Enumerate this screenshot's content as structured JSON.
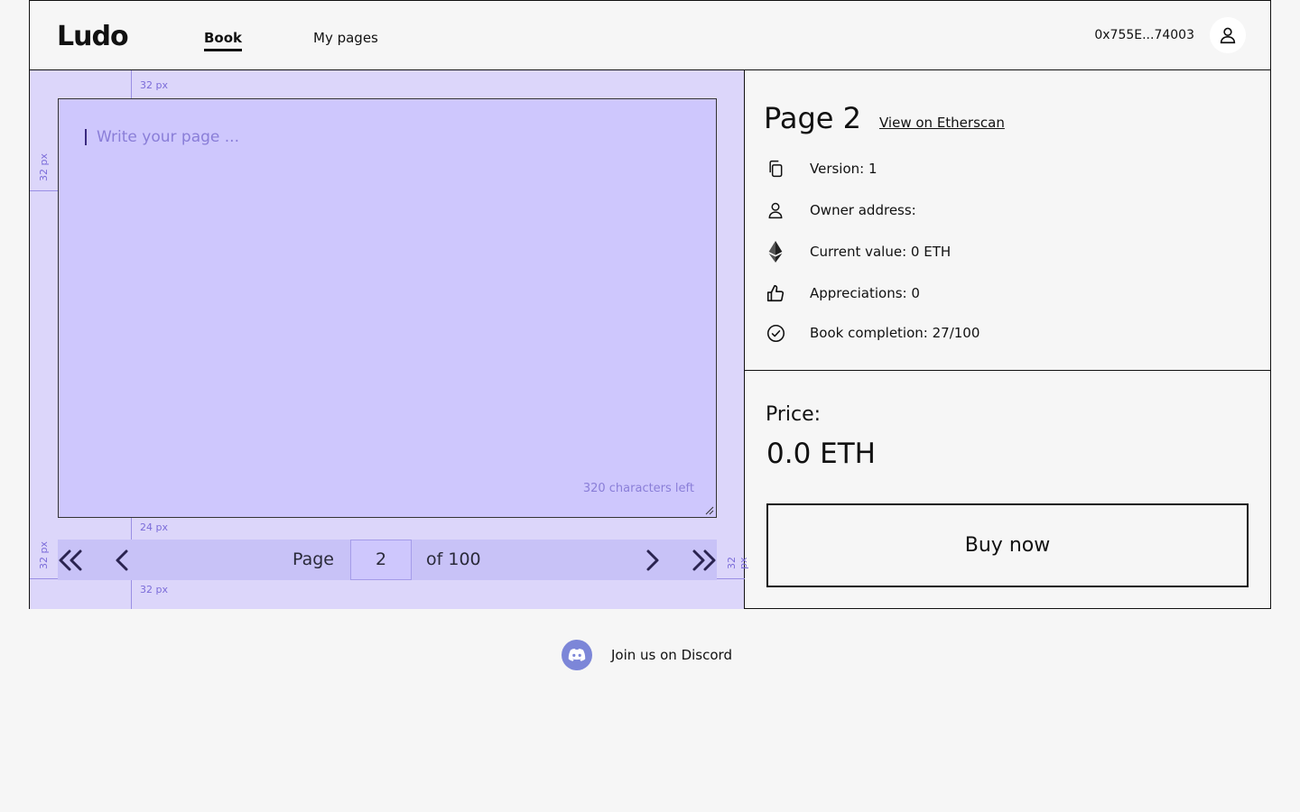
{
  "header": {
    "logo": "Ludo",
    "nav": {
      "book": "Book",
      "my_pages": "My pages"
    },
    "wallet": "0x755E...74003"
  },
  "editor": {
    "placeholder": "Write your page ...",
    "chars_left": "320 characters left",
    "spacing": {
      "top": "32 px",
      "left": "32 px",
      "gap": "24 px",
      "bottom": "32 px",
      "pager_left": "32 px",
      "pager_right": "32 px"
    }
  },
  "pager": {
    "label": "Page",
    "current": "2",
    "of": "of 100"
  },
  "info": {
    "title": "Page 2",
    "etherscan": "View on Etherscan",
    "version": "Version: 1",
    "owner": "Owner address:",
    "value": "Current value: 0 ETH",
    "appreciations": "Appreciations: 0",
    "completion": "Book completion: 27/100"
  },
  "purchase": {
    "price_label": "Price:",
    "price_value": "0.0 ETH",
    "buy_label": "Buy now"
  },
  "footer": {
    "discord": "Join us on Discord"
  },
  "colors": {
    "editor_bg": "#dcd6fa",
    "textarea_bg": "#cec7fd",
    "pager_bg": "#c8c2f7",
    "accent": "#7b6cd9",
    "discord": "#7c86d8"
  },
  "icons": [
    "user-icon",
    "copy-icon",
    "ethereum-icon",
    "thumbs-up-icon",
    "check-circle-icon",
    "discord-icon",
    "first-page-icon",
    "prev-page-icon",
    "next-page-icon",
    "last-page-icon"
  ]
}
